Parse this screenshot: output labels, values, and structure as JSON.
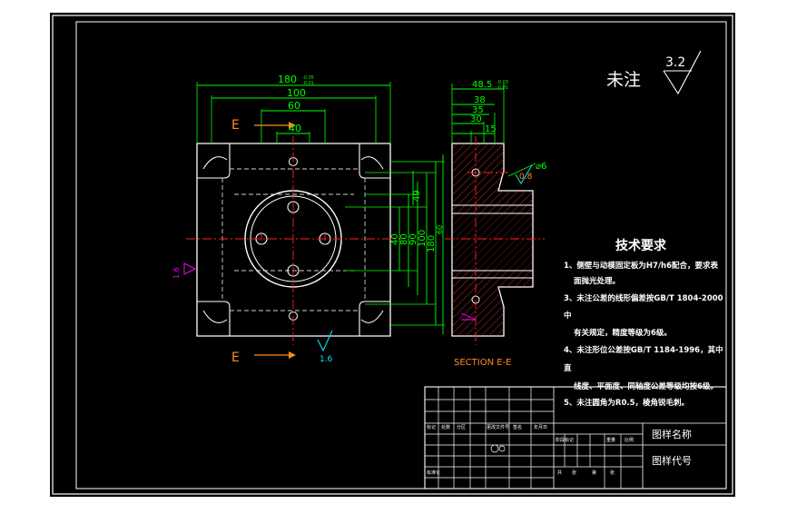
{
  "colors": {
    "background": "#000000",
    "page": "#ffffff",
    "frame": "#ffffff",
    "dimension": "#00ff00",
    "centerline": "#ff2020",
    "hidden": "#d0d0d0",
    "section_mark": "#ff8c1a",
    "roughness": "#00e5ff",
    "hatch": "#ff3030",
    "magenta": "#ff00ff",
    "text": "#ffffff"
  },
  "roughness_note": {
    "label": "未注",
    "value": "3.2"
  },
  "front_view": {
    "dims_horizontal": [
      {
        "value": "180",
        "tol_upper": "-0.05",
        "tol_lower": "-0.01"
      },
      {
        "value": "100"
      },
      {
        "value": "60"
      },
      {
        "value": "40"
      }
    ],
    "dims_vertical": [
      "49",
      "40",
      "80",
      "90",
      "100",
      "180",
      "60"
    ],
    "section_label_top": "E",
    "section_label_bottom": "E",
    "roughness_bottom": "1.6",
    "roughness_left": "1.6"
  },
  "section_view": {
    "dims_horizontal": [
      {
        "value": "48.5",
        "tol_upper": "-0.03",
        "tol_lower": "-0.01"
      },
      {
        "value": "38"
      },
      {
        "value": "35"
      },
      {
        "value": "30"
      },
      {
        "value": "15"
      }
    ],
    "hole_dim": "⌀6",
    "roughness": "0.8",
    "caption": "SECTION E-E"
  },
  "tech_requirements": {
    "title": "技术要求",
    "lines": [
      "1、侧壁与动模固定板为H7/h6配合，要求表",
      "面抛光处理。",
      "3、未注公差的线形偏差按GB/T 1804-2000",
      "中",
      "有关规定，精度等级为6级。",
      "4、未注形位公差按GB/T 1184-1996，其中",
      "直",
      "线度、平面度、同轴度公差等级均按6级。",
      "5、未注圆角为R0.5，棱角锐毛刺。"
    ]
  },
  "title_block": {
    "drawing_name": "图样名称",
    "drawing_code": "图样代号",
    "small_labels": [
      "标记",
      "处数",
      "分区",
      "更改文件号",
      "签名",
      "年月日",
      "标准化",
      "阶段标记",
      "重量",
      "比例",
      "共",
      "张",
      "第",
      "张"
    ]
  }
}
